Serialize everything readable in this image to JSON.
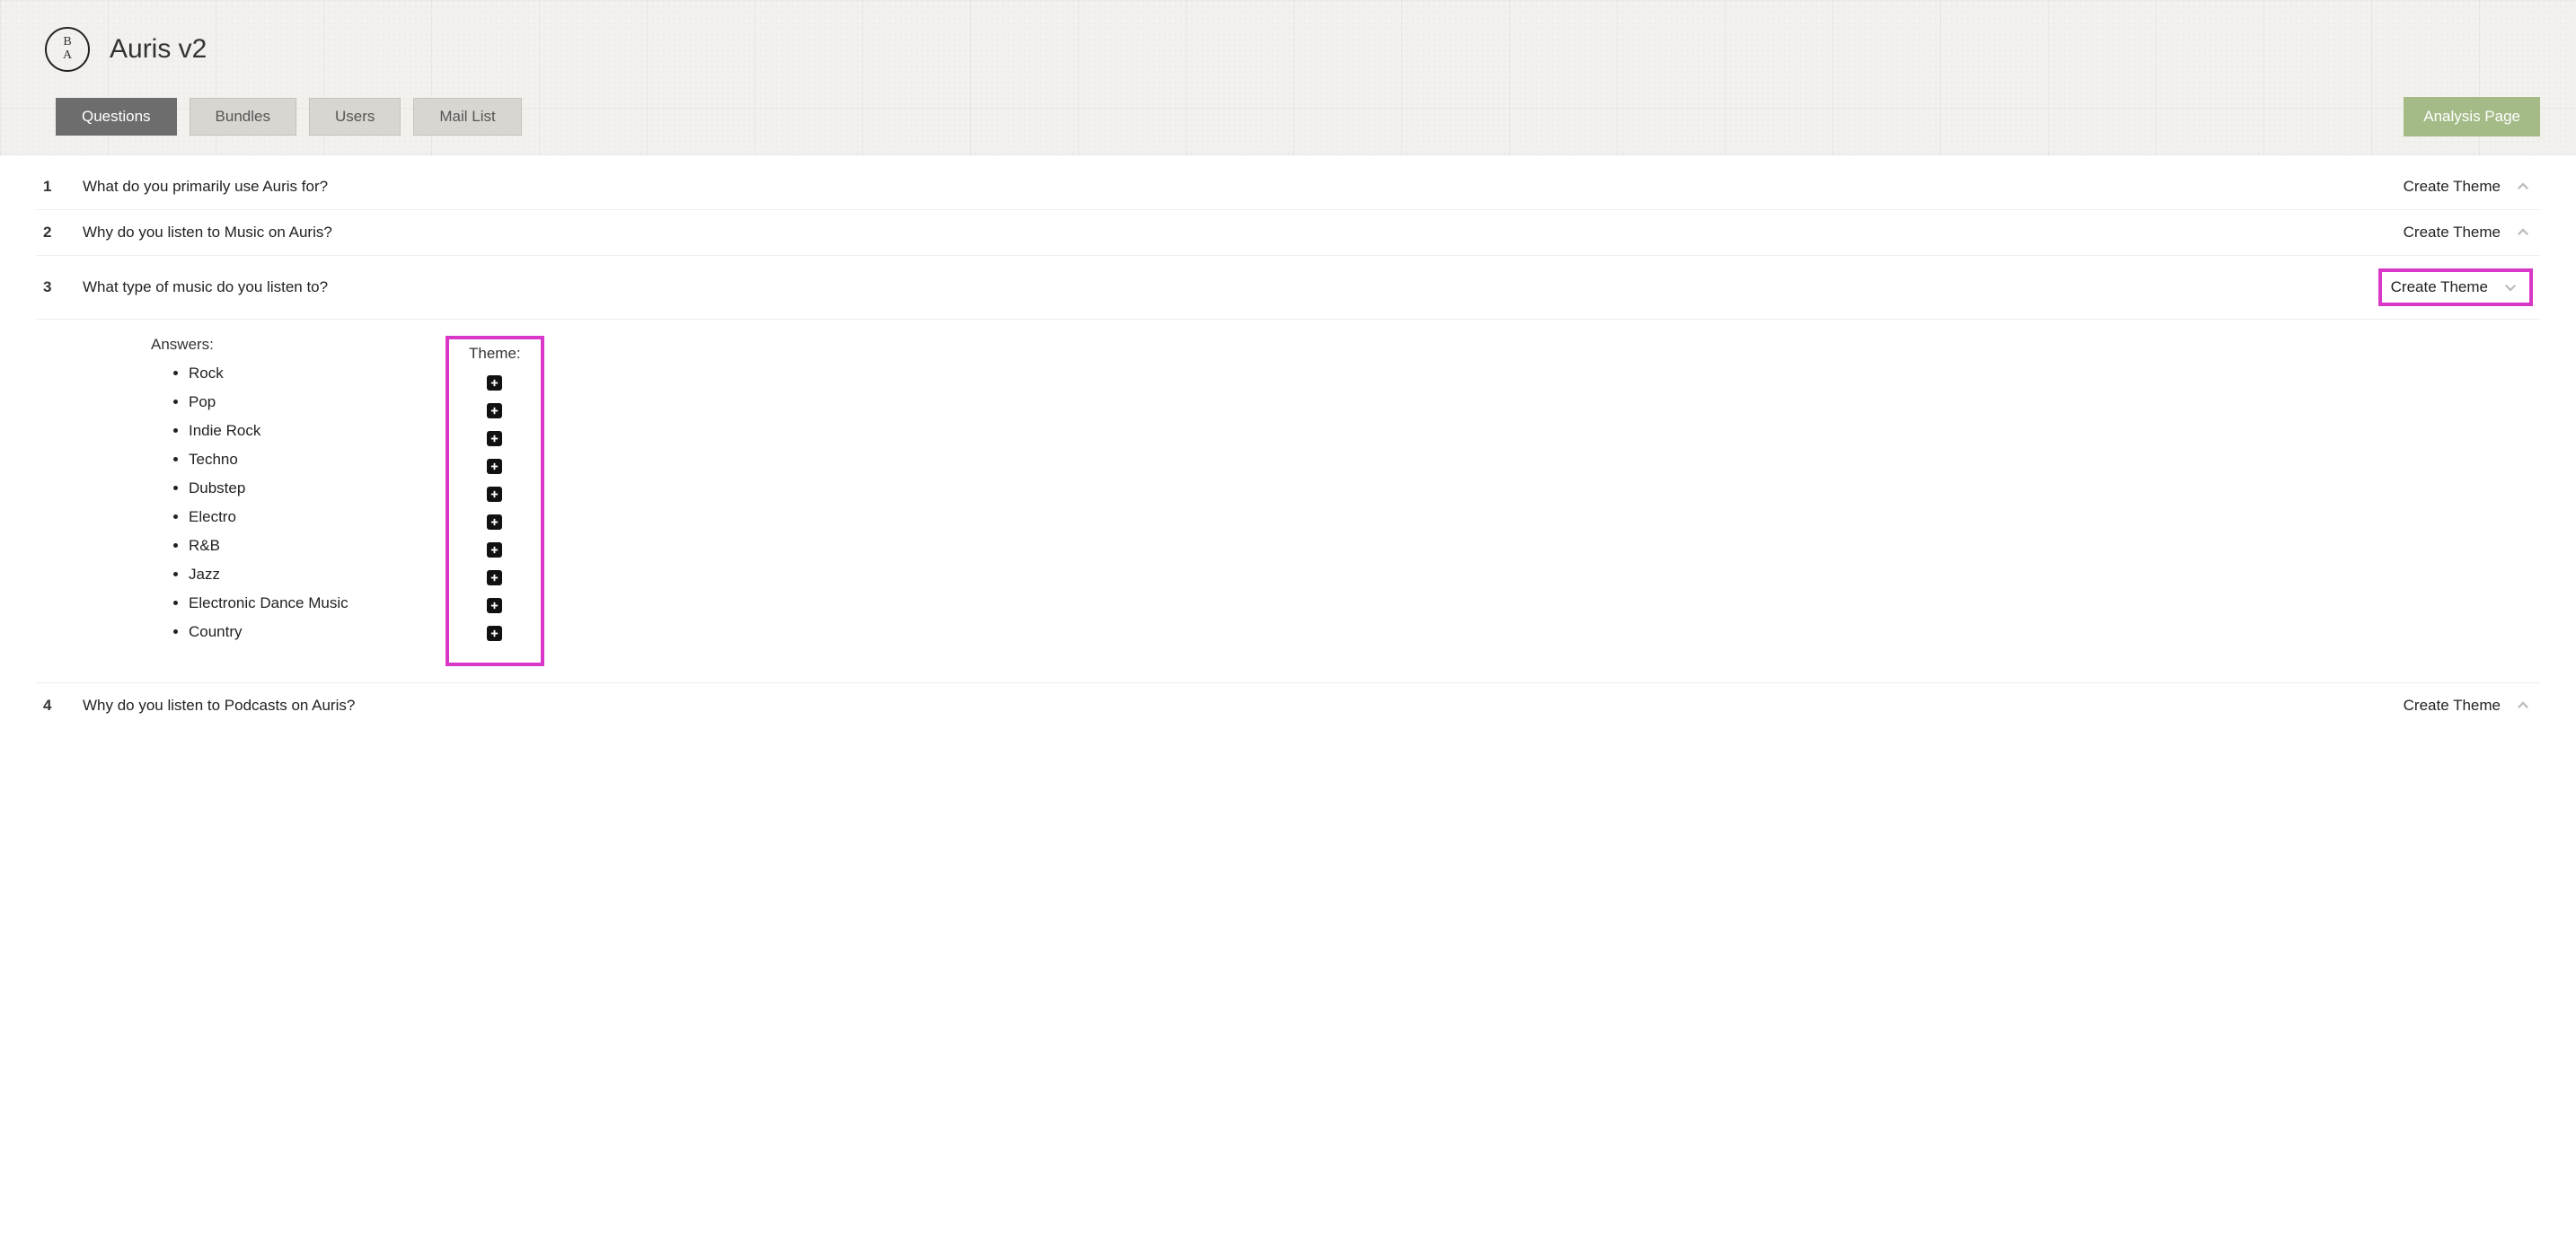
{
  "logo": {
    "line1": "B",
    "line2": "A"
  },
  "app_title": "Auris v2",
  "tabs": [
    {
      "label": "Questions",
      "active": true
    },
    {
      "label": "Bundles",
      "active": false
    },
    {
      "label": "Users",
      "active": false
    },
    {
      "label": "Mail List",
      "active": false
    }
  ],
  "analysis_button": "Analysis Page",
  "create_theme_label": "Create Theme",
  "answers_heading": "Answers:",
  "theme_heading": "Theme:",
  "questions": [
    {
      "num": "1",
      "text": "What do you primarily use Auris for?",
      "expanded": false
    },
    {
      "num": "2",
      "text": "Why do you listen to Music on Auris?",
      "expanded": false
    },
    {
      "num": "3",
      "text": "What type of music do you listen to?",
      "expanded": true
    },
    {
      "num": "4",
      "text": "Why do you listen to Podcasts on Auris?",
      "expanded": false
    }
  ],
  "q3_answers": [
    "Rock",
    "Pop",
    "Indie Rock",
    "Techno",
    "Dubstep",
    "Electro",
    "R&B",
    "Jazz",
    "Electronic Dance Music",
    "Country"
  ]
}
